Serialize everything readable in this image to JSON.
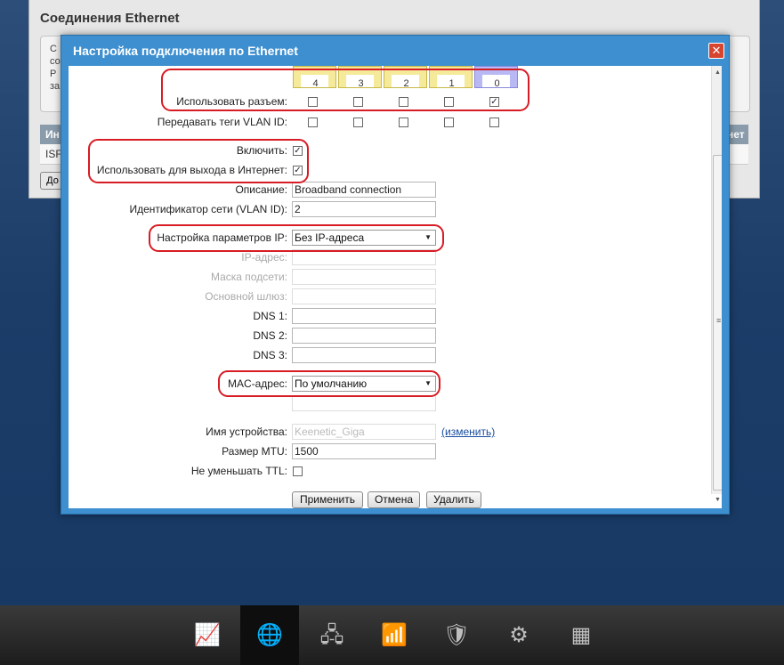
{
  "background": {
    "title": "Соединения Ethernet",
    "box_lines": [
      "С",
      "со",
      "Р",
      "за"
    ],
    "table_head_left": "Ин",
    "table_head_right": "нет",
    "row_cell": "ISF",
    "button_label": "До"
  },
  "dialog": {
    "title": "Настройка подключения по Ethernet",
    "close_glyph": "✕"
  },
  "ports": {
    "labels": [
      "4",
      "3",
      "2",
      "1",
      "0"
    ],
    "use_label": "Использовать разъем:",
    "use_checked": [
      false,
      false,
      false,
      false,
      true
    ],
    "vlan_tags_label": "Передавать теги VLAN ID:",
    "vlan_checked": [
      false,
      false,
      false,
      false,
      false
    ]
  },
  "form": {
    "enable_label": "Включить:",
    "enable_checked": true,
    "internet_label": "Использовать для выхода в Интернет:",
    "internet_checked": true,
    "description_label": "Описание:",
    "description_value": "Broadband connection",
    "vlan_id_label": "Идентификатор сети (VLAN ID):",
    "vlan_id_value": "2",
    "ip_settings_label": "Настройка параметров IP:",
    "ip_settings_value": "Без IP-адреса",
    "ip_label": "IP-адрес:",
    "mask_label": "Маска подсети:",
    "gateway_label": "Основной шлюз:",
    "dns1_label": "DNS 1:",
    "dns2_label": "DNS 2:",
    "dns3_label": "DNS 3:",
    "mac_label": "MAC-адрес:",
    "mac_value": "По умолчанию",
    "hostname_label": "Имя устройства:",
    "hostname_value": "Keenetic_Giga",
    "hostname_change": "(изменить)",
    "mtu_label": "Размер MTU:",
    "mtu_value": "1500",
    "ttl_label": "Не уменьшать TTL:",
    "ttl_checked": false
  },
  "buttons": {
    "apply": "Применить",
    "cancel": "Отмена",
    "delete": "Удалить"
  },
  "taskbar": {
    "items": [
      {
        "name": "monitor",
        "glyph": "📈"
      },
      {
        "name": "internet",
        "glyph": "🌐"
      },
      {
        "name": "home-network",
        "glyph": "🖧"
      },
      {
        "name": "wifi",
        "glyph": "📶"
      },
      {
        "name": "security",
        "glyph": "🛡"
      },
      {
        "name": "system",
        "glyph": "⚙"
      },
      {
        "name": "apps",
        "glyph": "▦"
      }
    ],
    "active_index": 1
  },
  "colors": {
    "highlight": "#d81c24",
    "dialog_title_bar": "#3d8fd0",
    "port_normal": "#f5ea9a",
    "port_selected": "#b8b8f4"
  }
}
